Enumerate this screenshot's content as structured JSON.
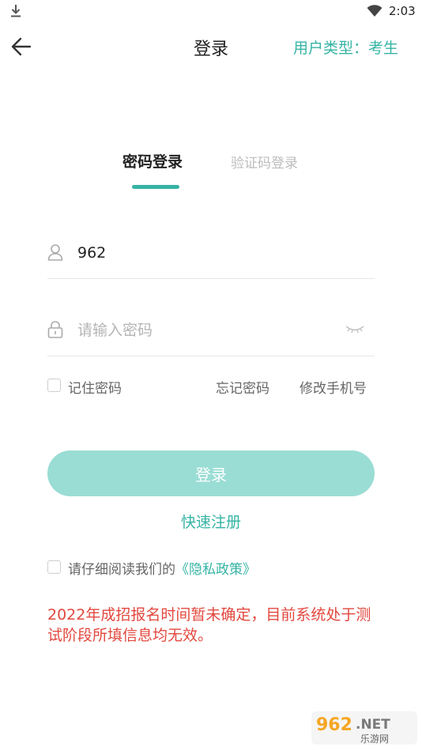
{
  "status_bar": {
    "time": "2:03"
  },
  "header": {
    "title": "登录",
    "user_type": "用户类型：考生"
  },
  "tabs": [
    {
      "label": "密码登录",
      "active": true
    },
    {
      "label": "验证码登录",
      "active": false
    }
  ],
  "form": {
    "username_value": "962",
    "password_placeholder": "请输入密码",
    "remember_label": "记住密码",
    "forgot_label": "忘记密码",
    "modify_phone_label": "修改手机号",
    "login_label": "登录",
    "register_label": "快速注册"
  },
  "privacy": {
    "prefix": "请仔细阅读我们的",
    "link": "《隐私政策》"
  },
  "notice": "2022年成招报名时间暂未确定，目前系统处于测试阶段所填信息均无效。",
  "colors": {
    "accent": "#36b3a4",
    "button": "#9addd4",
    "notice": "#e2483f"
  },
  "watermark": {
    "text": "962.NET 乐游网"
  }
}
